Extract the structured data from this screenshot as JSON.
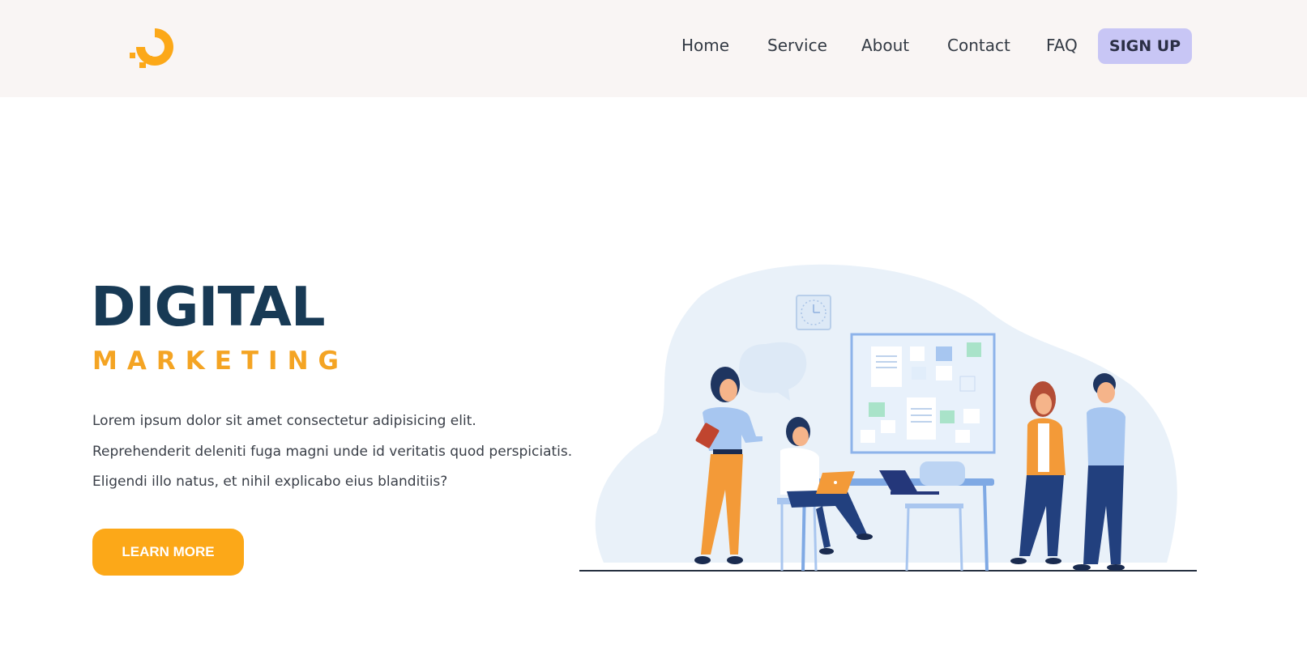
{
  "header": {
    "logo_icon": "digitalocean-logo-icon",
    "nav": [
      {
        "label": "Home"
      },
      {
        "label": "Service"
      },
      {
        "label": "About"
      },
      {
        "label": "Contact"
      },
      {
        "label": "FAQ"
      }
    ],
    "signup_label": "SIGN UP"
  },
  "hero": {
    "title": "DIGITAL",
    "subtitle": "MARKETING",
    "lines": [
      "Lorem ipsum dolor sit amet consectetur adipisicing elit.",
      "Reprehenderit deleniti fuga magni unde id veritatis quod perspiciatis.",
      "Eligendi illo natus, et nihil explicabo eius blanditiis?"
    ],
    "cta_label": "LEARN MORE",
    "illustration_icon": "team-office-illustration"
  },
  "colors": {
    "header_bg": "#f9f5f4",
    "accent": "#fca818",
    "title": "#183a55",
    "signup_bg": "#c8c6f5"
  }
}
